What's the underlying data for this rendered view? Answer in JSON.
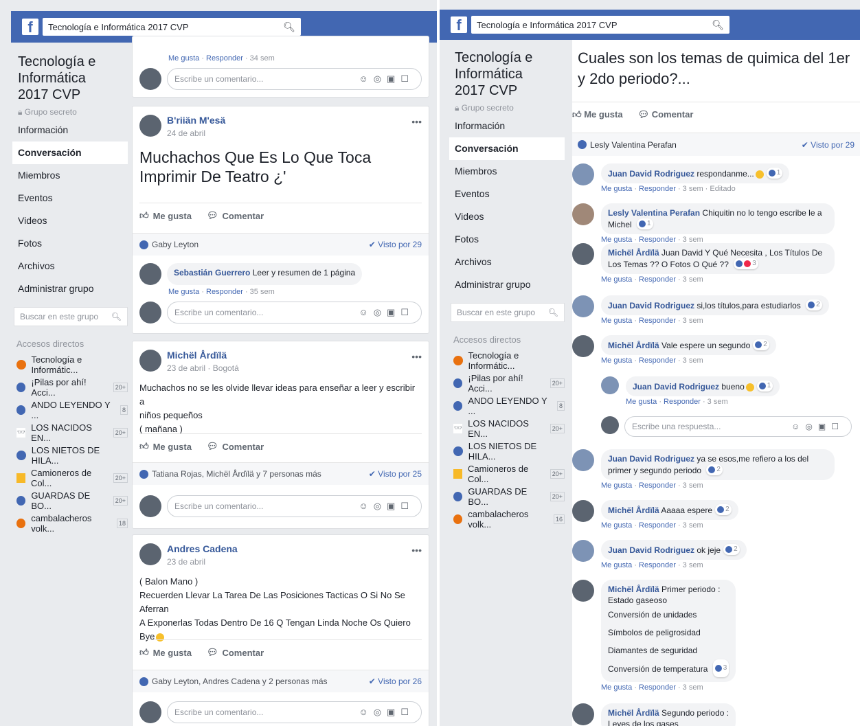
{
  "left": {
    "search_text": "Tecnología e Informática 2017 CVP",
    "group_title": "Tecnología e Informática 2017 CVP",
    "group_privacy": "Grupo secreto",
    "nav": [
      "Información",
      "Conversación",
      "Miembros",
      "Eventos",
      "Videos",
      "Fotos",
      "Archivos",
      "Administrar grupo"
    ],
    "group_search_placeholder": "Buscar en este grupo",
    "shortcuts_title": "Accesos directos",
    "shortcuts": [
      {
        "label": "Tecnología e Informátic...",
        "count": ""
      },
      {
        "label": "¡Pilas por ahí! Acci...",
        "count": "20+"
      },
      {
        "label": "ANDO LEYENDO Y ...",
        "count": "8"
      },
      {
        "label": "LOS NACIDOS EN...",
        "count": "20+"
      },
      {
        "label": "LOS NIETOS DE HILA...",
        "count": ""
      },
      {
        "label": "Camioneros de Col...",
        "count": "20+"
      },
      {
        "label": "GUARDAS DE BO...",
        "count": "20+"
      },
      {
        "label": "cambalacheros volk...",
        "count": "18"
      }
    ],
    "top_comment_meta": {
      "like": "Me gusta",
      "reply": "Responder",
      "time": "34 sem"
    },
    "comment_placeholder": "Escribe un comentario...",
    "posts": [
      {
        "author": "B'riiän M'esä",
        "date": "24 de abril",
        "text": "Muchachos Que Es Lo Que Toca Imprimir De Teatro ¿'",
        "reactors": "Gaby Leyton",
        "seen": "Visto por 29",
        "comment": {
          "author": "Sebastián Guerrero",
          "text": "Leer y resumen de 1 página",
          "like": "Me gusta",
          "reply": "Responder",
          "time": "35 sem"
        }
      },
      {
        "author": "Michël Årdïlä",
        "date": "23 de abril · Bogotá",
        "line1": "Muchachos no se les olvide llevar ideas para enseñar a leer y escribir a",
        "line2": "niños pequeños",
        "line3": "( mañana )",
        "reactors": "Tatiana Rojas, Michël Årdïlä y 7 personas más",
        "seen": "Visto por 25"
      },
      {
        "author": "Andres Cadena",
        "date": "23 de abril",
        "line1": "( Balon Mano )",
        "line2": "Recuerden Llevar La Tarea De Las Posiciones Tacticas O Si No Se Aferran",
        "line3": "A Exponerlas Todas Dentro De 16 Q Tengan Linda Noche Os Quiero Bye",
        "reactors": "Gaby Leyton, Andres Cadena y 2 personas más",
        "seen": "Visto por 26"
      }
    ],
    "like_label": "Me gusta",
    "comment_label": "Comentar"
  },
  "right": {
    "search_text": "Tecnología e Informática 2017 CVP",
    "group_title": "Tecnología e Informática 2017 CVP",
    "group_privacy": "Grupo secreto",
    "nav": [
      "Información",
      "Conversación",
      "Miembros",
      "Eventos",
      "Videos",
      "Fotos",
      "Archivos",
      "Administrar grupo"
    ],
    "group_search_placeholder": "Buscar en este grupo",
    "shortcuts_title": "Accesos directos",
    "shortcuts": [
      {
        "label": "Tecnología e Informátic...",
        "count": ""
      },
      {
        "label": "¡Pilas por ahí! Acci...",
        "count": "20+"
      },
      {
        "label": "ANDO LEYENDO Y ...",
        "count": "8"
      },
      {
        "label": "LOS NACIDOS EN...",
        "count": "20+"
      },
      {
        "label": "LOS NIETOS DE HILA...",
        "count": ""
      },
      {
        "label": "Camioneros de Col...",
        "count": "20+"
      },
      {
        "label": "GUARDAS DE BO...",
        "count": "20+"
      },
      {
        "label": "cambalacheros volk...",
        "count": "16"
      }
    ],
    "post_title": "Cuales son los temas de quimica del 1er y 2do periodo?...",
    "like_label": "Me gusta",
    "comment_label": "Comentar",
    "reactors": "Lesly Valentina Perafan",
    "seen": "Visto por 29",
    "reply_placeholder": "Escribe una respuesta...",
    "comments": [
      {
        "author": "Juan David Rodriguez",
        "text": "respondanme...",
        "meta": "3 sem · Editado",
        "count": "1"
      },
      {
        "author": "Lesly Valentina Perafan",
        "text": "Chiquitin no lo tengo escribe le a Michel",
        "meta": "3 sem",
        "count": "1"
      },
      {
        "author": "Michël Årdïlä",
        "text": "Juan David Y Qué Necesita , Los Títulos De Los Temas ?? O Fotos O Qué ??",
        "meta": "3 sem",
        "count": "3"
      },
      {
        "author": "Juan David Rodriguez",
        "text": "si,los títulos,para estudiarlos",
        "meta": "3 sem",
        "count": "2"
      },
      {
        "author": "Michël Årdïlä",
        "text": "Vale espere un segundo",
        "meta": "3 sem",
        "count": "2"
      },
      {
        "author": "Juan David Rodriguez",
        "text": "bueno",
        "meta": "3 sem",
        "count": "1"
      },
      {
        "author": "Juan David Rodriguez",
        "text": "ya se esos,me refiero a los del primer y segundo periodo",
        "meta": "3 sem",
        "count": "2"
      },
      {
        "author": "Michël Årdïlä",
        "text": "Aaaaa espere",
        "meta": "3 sem",
        "count": "2"
      },
      {
        "author": "Juan David Rodriguez",
        "text": "ok jeje",
        "meta": "3 sem",
        "count": "2"
      },
      {
        "author": "Michël Årdïlä",
        "text": "Primer periodo :",
        "lines": [
          "Estado gaseoso",
          "Conversión de unidades",
          "Símbolos de peligrosidad",
          "Diamantes de seguridad",
          "Conversión de temperatura"
        ],
        "meta": "3 sem",
        "count": "3"
      },
      {
        "author": "Michël Årdïlä",
        "text": "Segundo periodo :",
        "lines": [
          "Leyes de los gases"
        ]
      }
    ],
    "meta_like": "Me gusta",
    "meta_reply": "Responder"
  }
}
